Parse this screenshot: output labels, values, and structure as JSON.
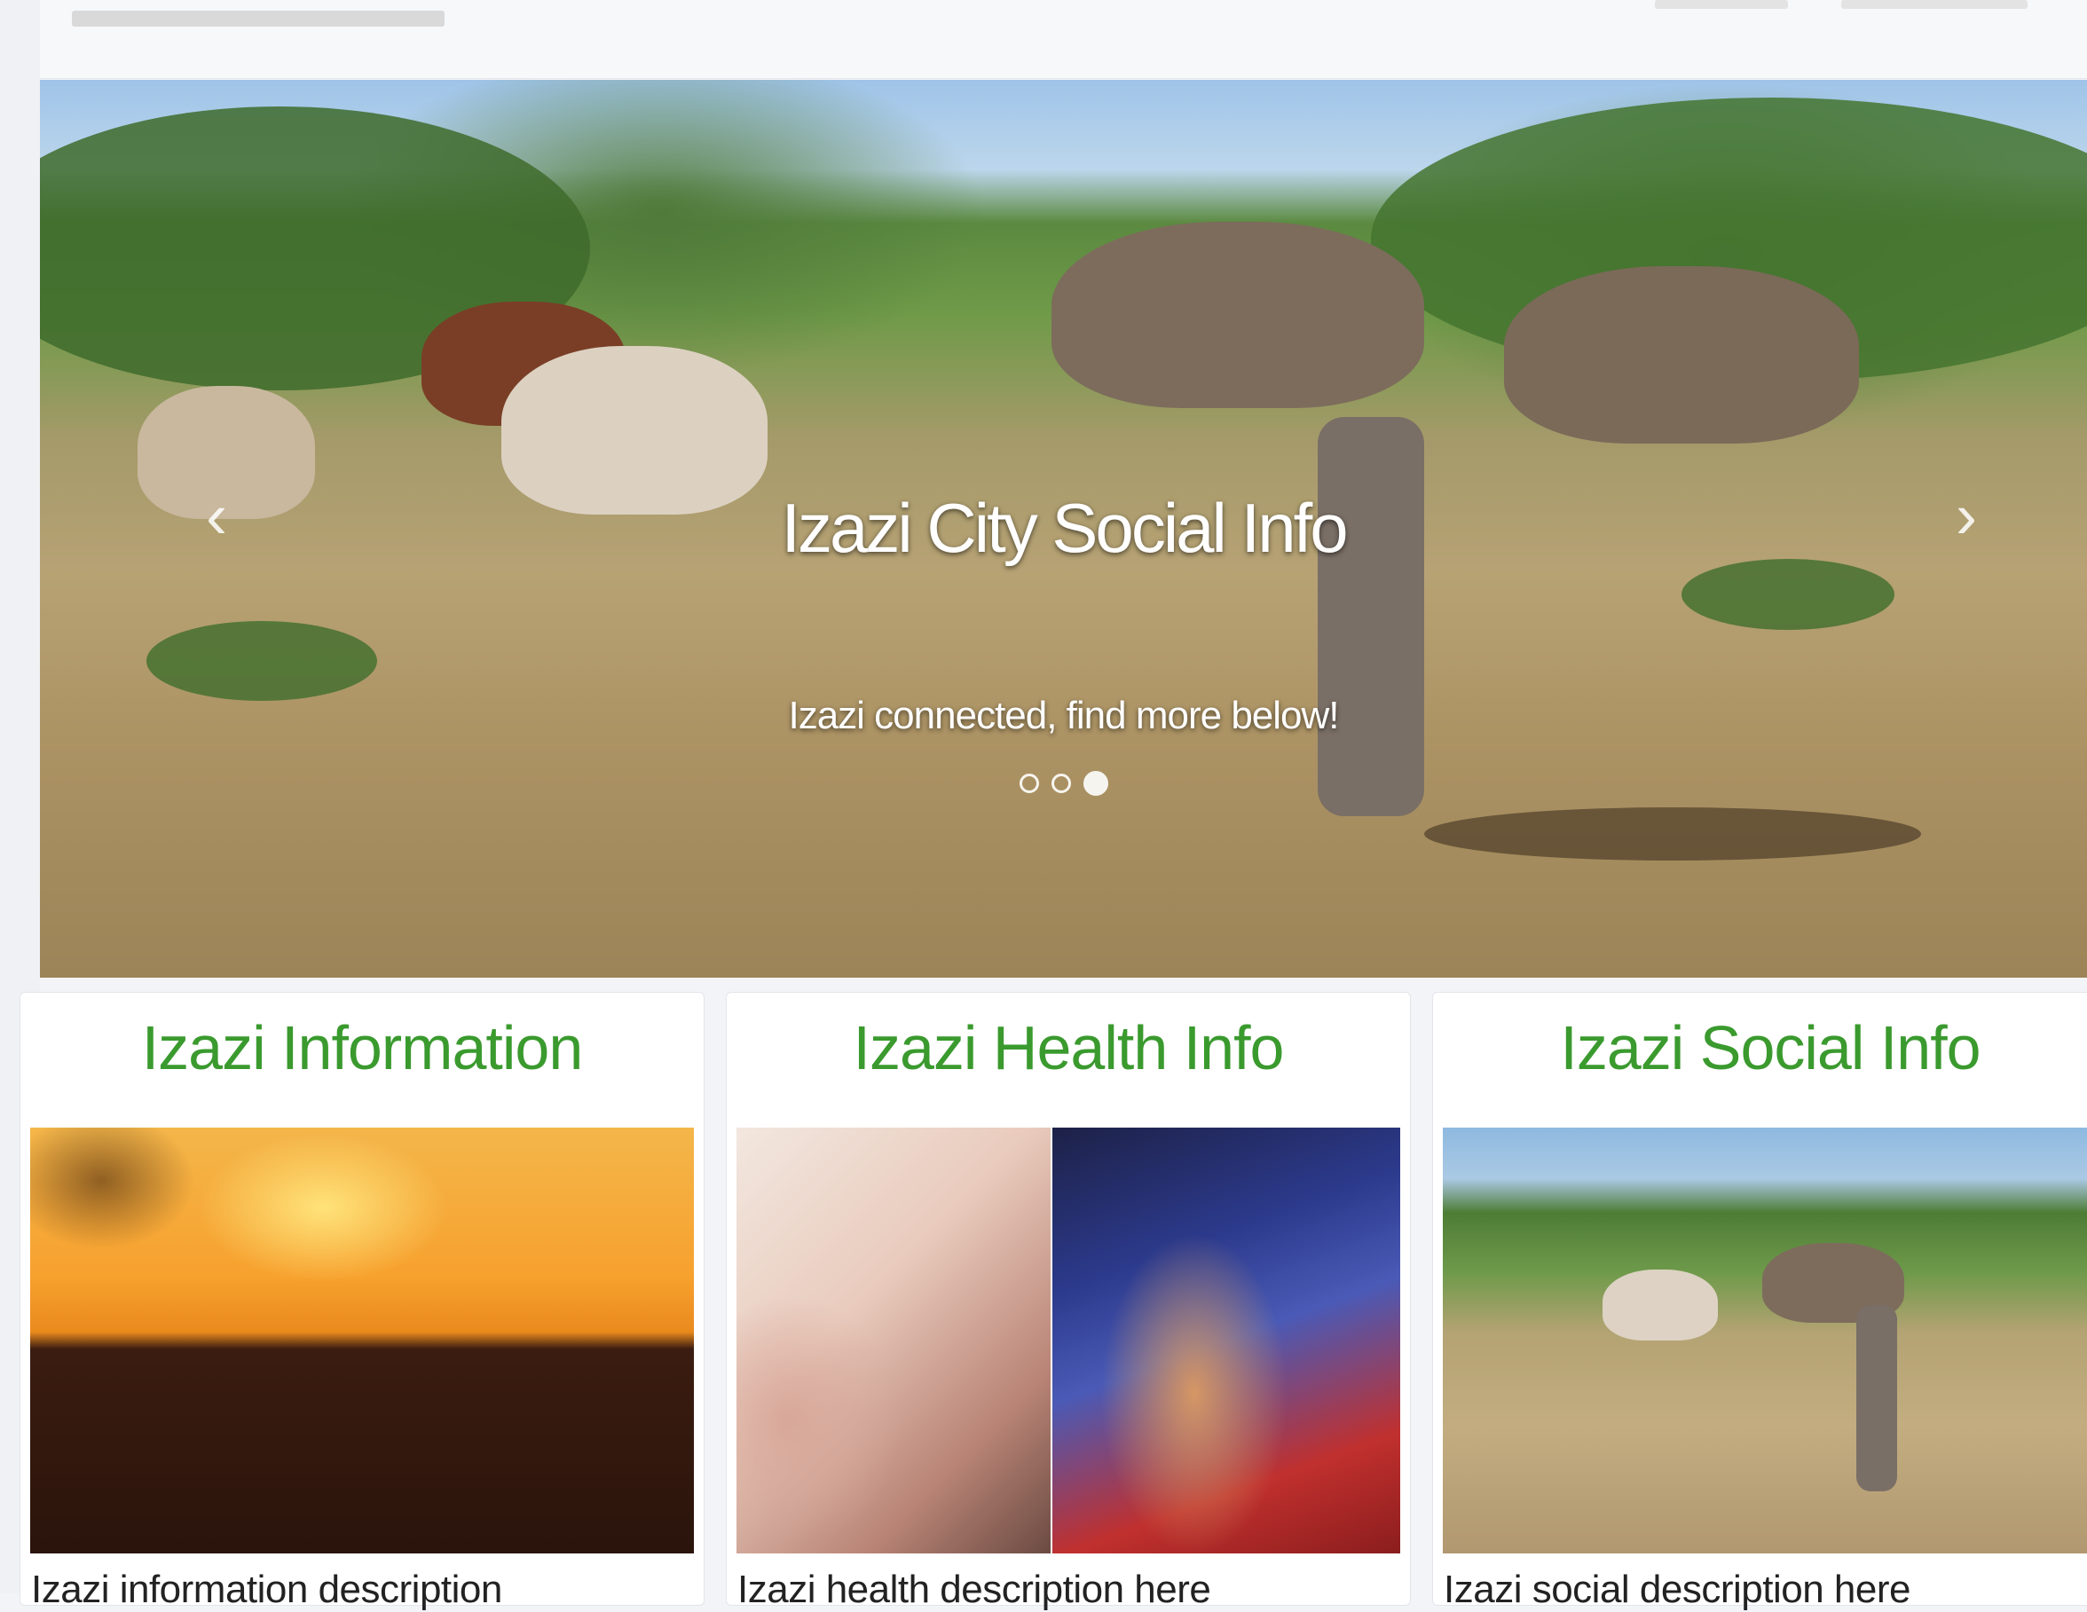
{
  "carousel": {
    "title": "Izazi City Social Info",
    "subtitle": "Izazi connected, find more below!",
    "prev_icon": "chevron-left-icon",
    "next_icon": "chevron-right-icon",
    "slide_count": 3,
    "active_slide": 3
  },
  "cards": [
    {
      "title": "Izazi Information",
      "description": "Izazi information description",
      "image": "sunset-photo"
    },
    {
      "title": "Izazi Health Info",
      "description": "Izazi health description here",
      "image": "health-photo"
    },
    {
      "title": "Izazi Social Info",
      "description": "Izazi social description here",
      "image": "village-photo"
    }
  ],
  "colors": {
    "card_title": "#3a9a2e",
    "page_background": "#f3f4f7"
  }
}
